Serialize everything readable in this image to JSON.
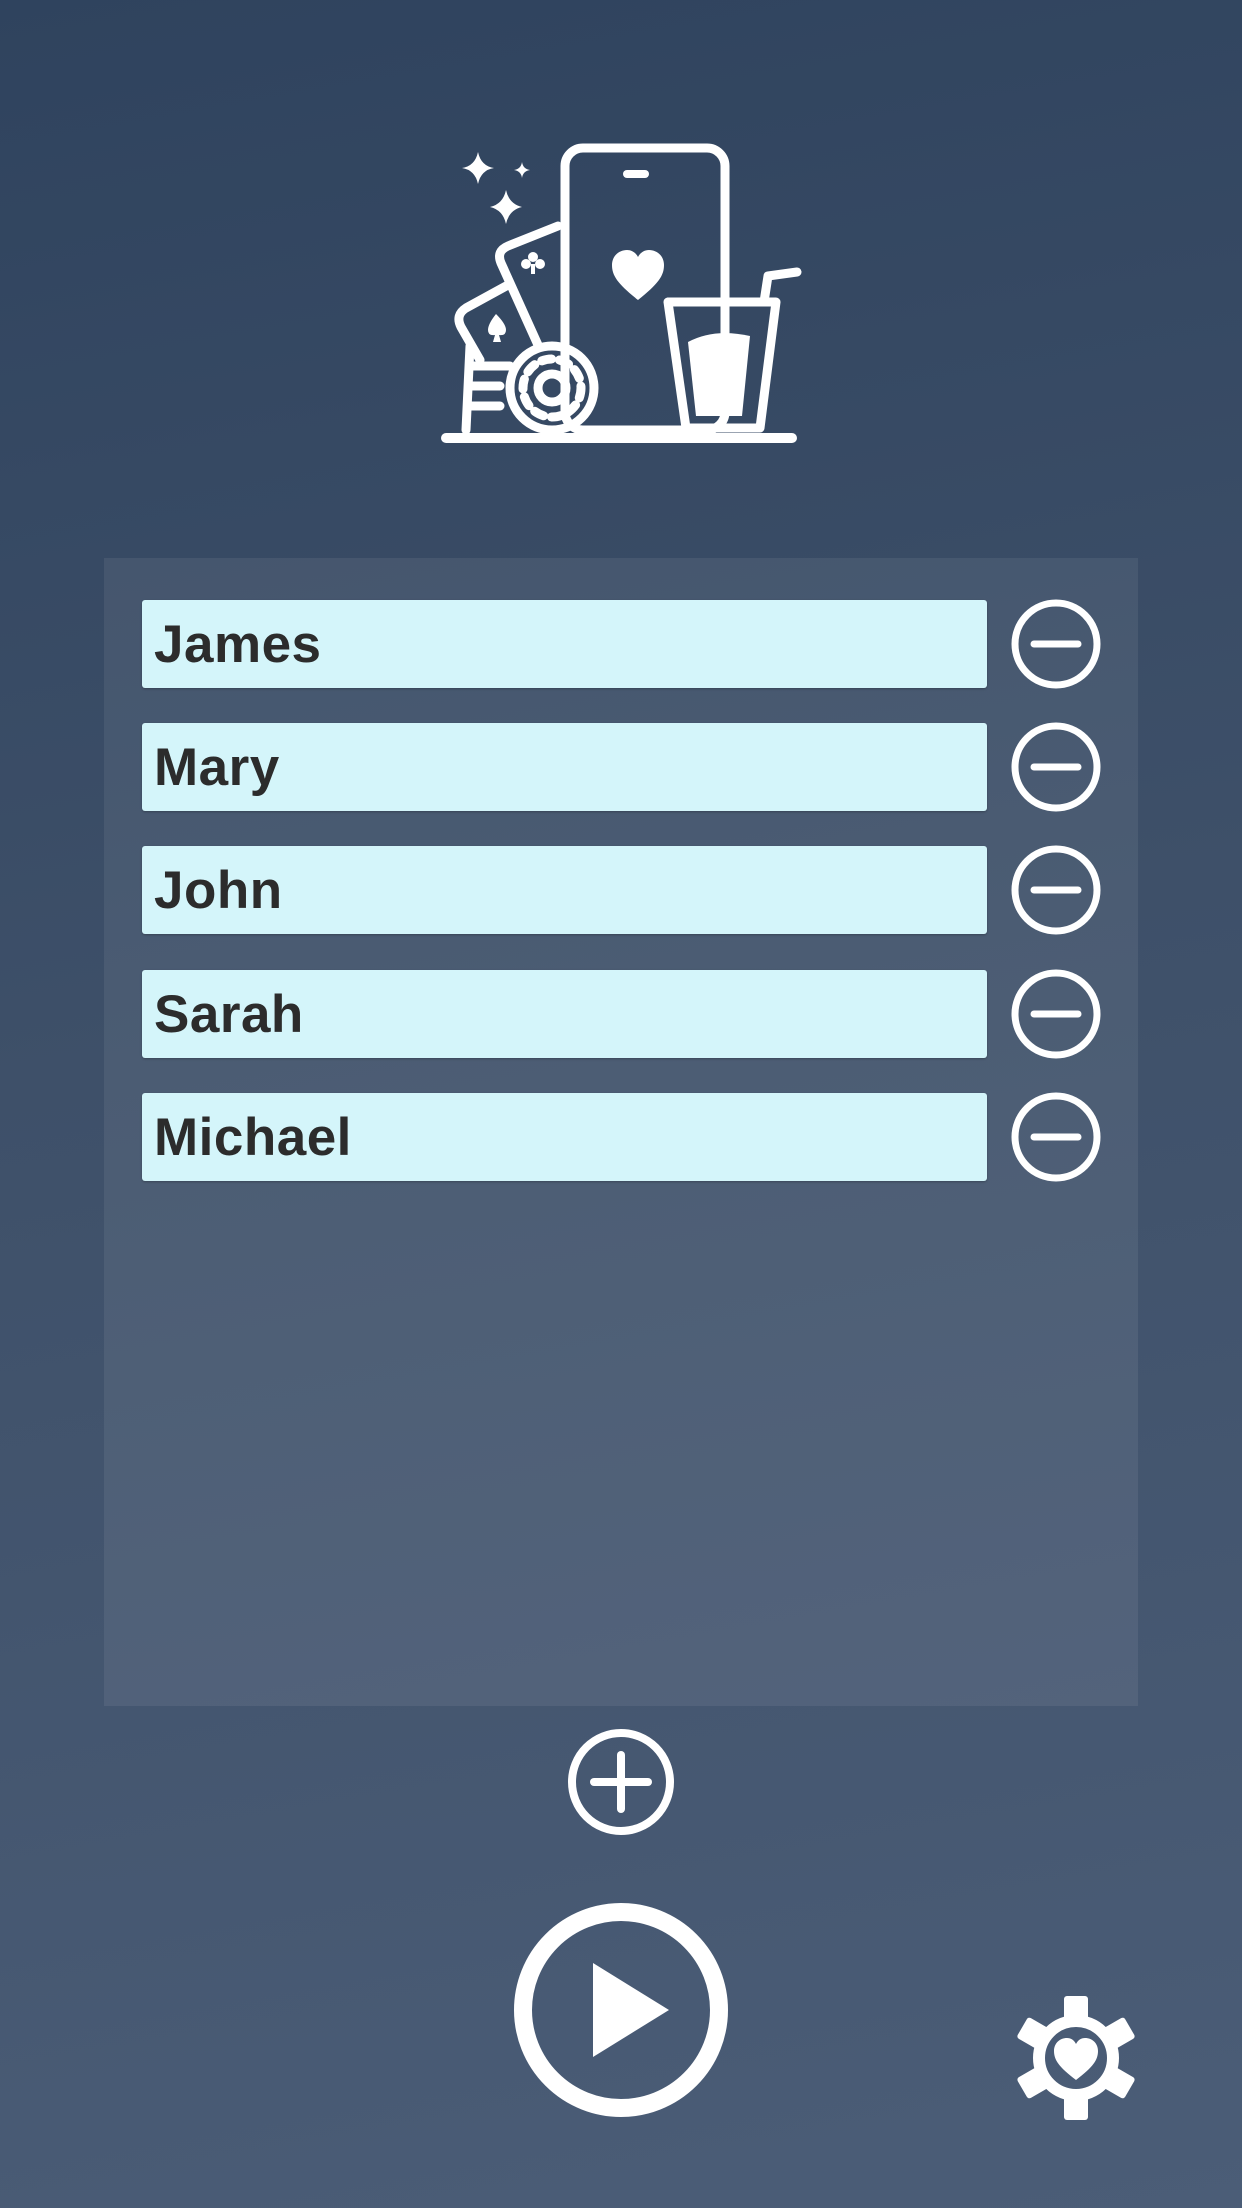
{
  "app": {
    "logo_icon": "party-game-logo-icon"
  },
  "players": [
    {
      "name": "James"
    },
    {
      "name": "Mary"
    },
    {
      "name": "John"
    },
    {
      "name": "Sarah"
    },
    {
      "name": "Michael"
    }
  ],
  "icons": {
    "remove": "minus-circle-icon",
    "add": "plus-circle-icon",
    "play": "play-circle-icon",
    "settings": "gear-heart-icon"
  },
  "colors": {
    "background_top": "#2f435e",
    "background_bottom": "#4b5d77",
    "field_background": "#d4f5fa",
    "field_text": "#2c2c2c",
    "icon": "#ffffff"
  }
}
